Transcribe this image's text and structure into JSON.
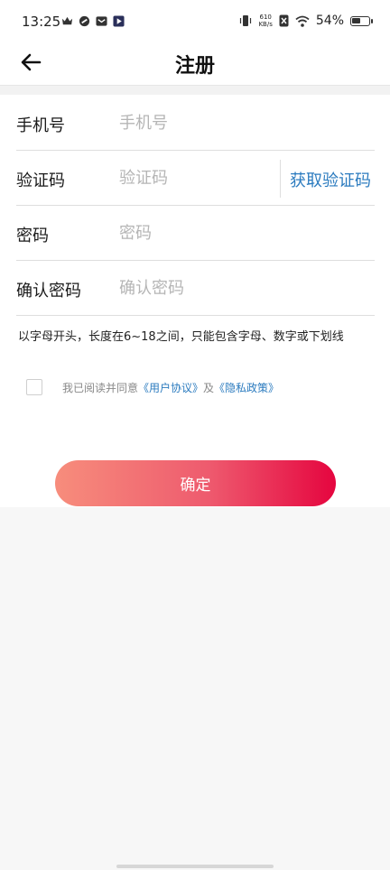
{
  "status_bar": {
    "time": "13:25",
    "net_speed_value": "610",
    "net_speed_unit": "KB/s",
    "battery_text": "54%",
    "battery_level": 0.54,
    "icons": [
      "crown-icon",
      "link-icon",
      "mail-icon",
      "play-icon",
      "vibrate-icon",
      "sim-off-icon",
      "wifi-icon",
      "battery-icon"
    ]
  },
  "header": {
    "title": "注册",
    "back_icon": "arrow-left-icon"
  },
  "form": {
    "phone": {
      "label": "手机号",
      "placeholder": "手机号",
      "value": ""
    },
    "code": {
      "label": "验证码",
      "placeholder": "验证码",
      "value": "",
      "get_code_label": "获取验证码"
    },
    "password": {
      "label": "密码",
      "placeholder": "密码",
      "value": ""
    },
    "confirm_password": {
      "label": "确认密码",
      "placeholder": "确认密码",
      "value": ""
    },
    "hint": "以字母开头，长度在6~18之间，只能包含字母、数字或下划线"
  },
  "agreement": {
    "checked": false,
    "prefix": "我已阅读并同意",
    "user_agreement": "《用户协议》",
    "conjunction": "及",
    "privacy_policy": "《隐私政策》"
  },
  "submit": {
    "label": "确定"
  },
  "colors": {
    "link": "#2b7bbf",
    "button_gradient_start": "#f78d7c",
    "button_gradient_end": "#e5053f",
    "placeholder": "#b5b5b5"
  }
}
